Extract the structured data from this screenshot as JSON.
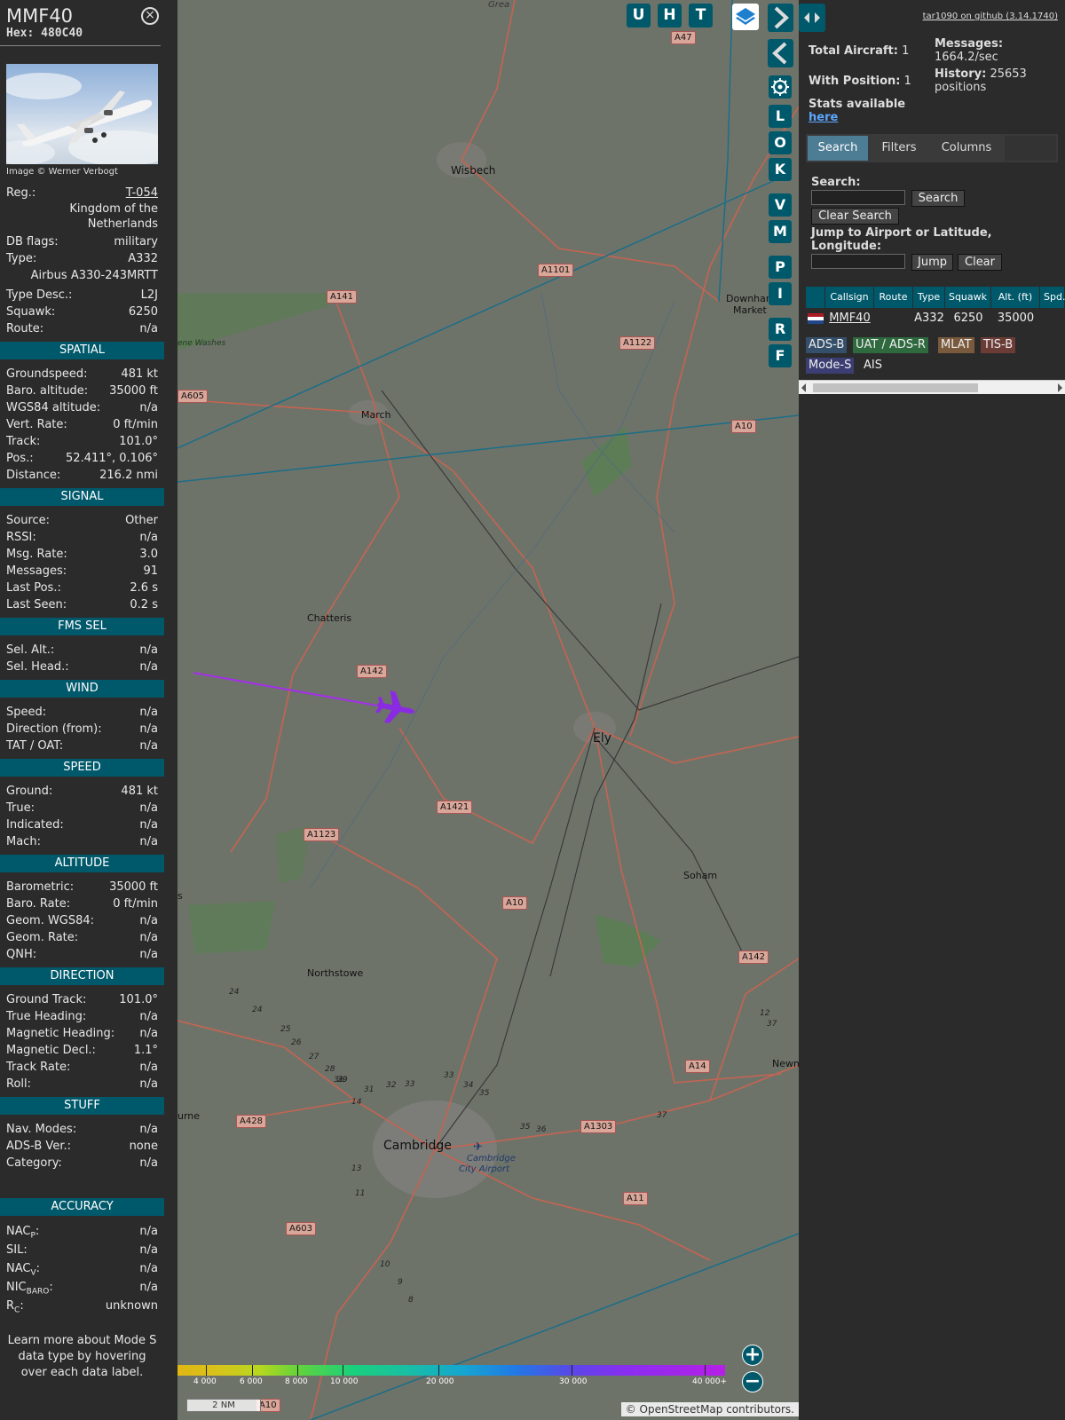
{
  "infoblock": {
    "callsign": "MMF40",
    "hex_label": "Hex:",
    "hex": "480C40",
    "photo_credit": "Image © Werner Verbogt",
    "reg_label": "Reg.:",
    "reg": "T-054",
    "country": "Kingdom of the Netherlands",
    "dbflags_label": "DB flags:",
    "dbflags": "military",
    "type_label": "Type:",
    "type": "A332",
    "type_full": "Airbus A330-243MRTT",
    "typedesc_label": "Type Desc.:",
    "typedesc": "L2J",
    "squawk_label": "Squawk:",
    "squawk": "6250",
    "route_label": "Route:",
    "route": "n/a",
    "sections": {
      "spatial": "SPATIAL",
      "signal": "SIGNAL",
      "fms": "FMS SEL",
      "wind": "WIND",
      "speed": "SPEED",
      "altitude": "ALTITUDE",
      "direction": "DIRECTION",
      "stuff": "STUFF",
      "accuracy": "ACCURACY"
    },
    "spatial": [
      {
        "l": "Groundspeed:",
        "v": "481 kt"
      },
      {
        "l": "Baro. altitude:",
        "v": "35000 ft"
      },
      {
        "l": "WGS84 altitude:",
        "v": "n/a"
      },
      {
        "l": "Vert. Rate:",
        "v": "0 ft/min"
      },
      {
        "l": "Track:",
        "v": "101.0°"
      },
      {
        "l": "Pos.:",
        "v": "52.411°, 0.106°"
      },
      {
        "l": "Distance:",
        "v": "216.2 nmi"
      }
    ],
    "signal": [
      {
        "l": "Source:",
        "v": "Other"
      },
      {
        "l": "RSSI:",
        "v": "n/a"
      },
      {
        "l": "Msg. Rate:",
        "v": "3.0"
      },
      {
        "l": "Messages:",
        "v": "91"
      },
      {
        "l": "Last Pos.:",
        "v": "2.6 s"
      },
      {
        "l": "Last Seen:",
        "v": "0.2 s"
      }
    ],
    "fms": [
      {
        "l": "Sel. Alt.:",
        "v": "n/a"
      },
      {
        "l": "Sel. Head.:",
        "v": "n/a"
      }
    ],
    "wind": [
      {
        "l": "Speed:",
        "v": "n/a"
      },
      {
        "l": "Direction (from):",
        "v": "n/a"
      },
      {
        "l": "TAT / OAT:",
        "v": "n/a"
      }
    ],
    "speed": [
      {
        "l": "Ground:",
        "v": "481 kt"
      },
      {
        "l": "True:",
        "v": "n/a"
      },
      {
        "l": "Indicated:",
        "v": "n/a"
      },
      {
        "l": "Mach:",
        "v": "n/a"
      }
    ],
    "altitude": [
      {
        "l": "Barometric:",
        "v": "35000 ft"
      },
      {
        "l": "Baro. Rate:",
        "v": "0 ft/min"
      },
      {
        "l": "Geom. WGS84:",
        "v": "n/a"
      },
      {
        "l": "Geom. Rate:",
        "v": "n/a"
      },
      {
        "l": "QNH:",
        "v": "n/a"
      }
    ],
    "direction": [
      {
        "l": "Ground Track:",
        "v": "101.0°"
      },
      {
        "l": "True Heading:",
        "v": "n/a"
      },
      {
        "l": "Magnetic Heading:",
        "v": "n/a"
      },
      {
        "l": "Magnetic Decl.:",
        "v": "1.1°"
      },
      {
        "l": "Track Rate:",
        "v": "n/a"
      },
      {
        "l": "Roll:",
        "v": "n/a"
      }
    ],
    "stuff": [
      {
        "l": "Nav. Modes:",
        "v": "n/a"
      },
      {
        "l": "ADS-B Ver.:",
        "v": "none"
      },
      {
        "l": "Category:",
        "v": "n/a"
      }
    ],
    "accuracy": [
      {
        "l": "NAC",
        "sub": "P",
        "v": "n/a"
      },
      {
        "l": "SIL:",
        "sub": "",
        "v": "n/a"
      },
      {
        "l": "NAC",
        "sub": "V",
        "v": "n/a"
      },
      {
        "l": "NIC",
        "sub": "BARO",
        "v": "n/a"
      },
      {
        "l": "R",
        "sub": "C",
        "v": "unknown"
      }
    ],
    "learn_more": "Learn more about Mode S data type by hovering over each data label."
  },
  "map": {
    "buttons_top": [
      "U",
      "H",
      "T"
    ],
    "buttons_side": [
      "L",
      "O",
      "K",
      "V",
      "M",
      "P",
      "I",
      "R",
      "F"
    ],
    "places": {
      "wisbech": "Wisbech",
      "downham": "Downham",
      "downham2": "Market",
      "march": "March",
      "chatteris": "Chatteris",
      "ely": "Ely",
      "soham": "Soham",
      "northstowe": "Northstowe",
      "cambridge": "Cambridge",
      "airport1": "Cambridge",
      "airport2": "City Airport",
      "newmarket": "Newmar",
      "washes": "ene Washes",
      "urne": "urne",
      "s": "s",
      "great": "Grea"
    },
    "roads": {
      "a47": "A47",
      "a1101": "A1101",
      "a141": "A141",
      "a1122": "A1122",
      "a605": "A605",
      "a10a": "A10",
      "a142a": "A142",
      "a1421": "A1421",
      "a1123": "A1123",
      "a10b": "A10",
      "a142b": "A142",
      "a14": "A14",
      "a428": "A428",
      "a1303": "A1303",
      "a603": "A603",
      "a11": "A11",
      "a10c": "A10"
    },
    "junctions": [
      "24",
      "24",
      "25",
      "26",
      "27",
      "28",
      "29",
      "30",
      "31",
      "31",
      "14",
      "32",
      "33",
      "33",
      "34",
      "35",
      "35",
      "36",
      "37",
      "37",
      "12",
      "13",
      "11",
      "10",
      "9",
      "8"
    ],
    "legend": [
      "4 000",
      "6 000",
      "8 000",
      "10 000",
      "20 000",
      "30 000",
      "40 000+"
    ],
    "scale": "2 NM",
    "attribution": "© OpenStreetMap contributors."
  },
  "side": {
    "github": "tar1090 on github (3.14.1740)",
    "total_label": "Total Aircraft:",
    "total": "1",
    "withpos_label": "With Position:",
    "withpos": "1",
    "messages_label": "Messages:",
    "messages": "1664.2/sec",
    "history_label": "History:",
    "history": "25653",
    "history_unit": "positions",
    "stats_label": "Stats available",
    "stats_link": "here",
    "tabs": [
      "Search",
      "Filters",
      "Columns"
    ],
    "search_label": "Search:",
    "search_btn": "Search",
    "clear_search_btn": "Clear Search",
    "jump_label": "Jump to Airport or Latitude, Longitude:",
    "jump_btn": "Jump",
    "clear_btn": "Clear",
    "table_headers": [
      "Callsign",
      "Route",
      "Type",
      "Squawk",
      "Alt. (ft)",
      "Spd."
    ],
    "table_row": {
      "callsign": "MMF40",
      "route": "",
      "type": "A332",
      "squawk": "6250",
      "alt": "35000"
    },
    "chips": [
      "ADS-B",
      "UAT / ADS-R",
      "MLAT",
      "TIS-B",
      "Mode-S",
      "AIS"
    ]
  },
  "colors": {
    "accent": "#00596b",
    "aircraft": "#8a2be2",
    "active_tab": "#4d7d95"
  }
}
